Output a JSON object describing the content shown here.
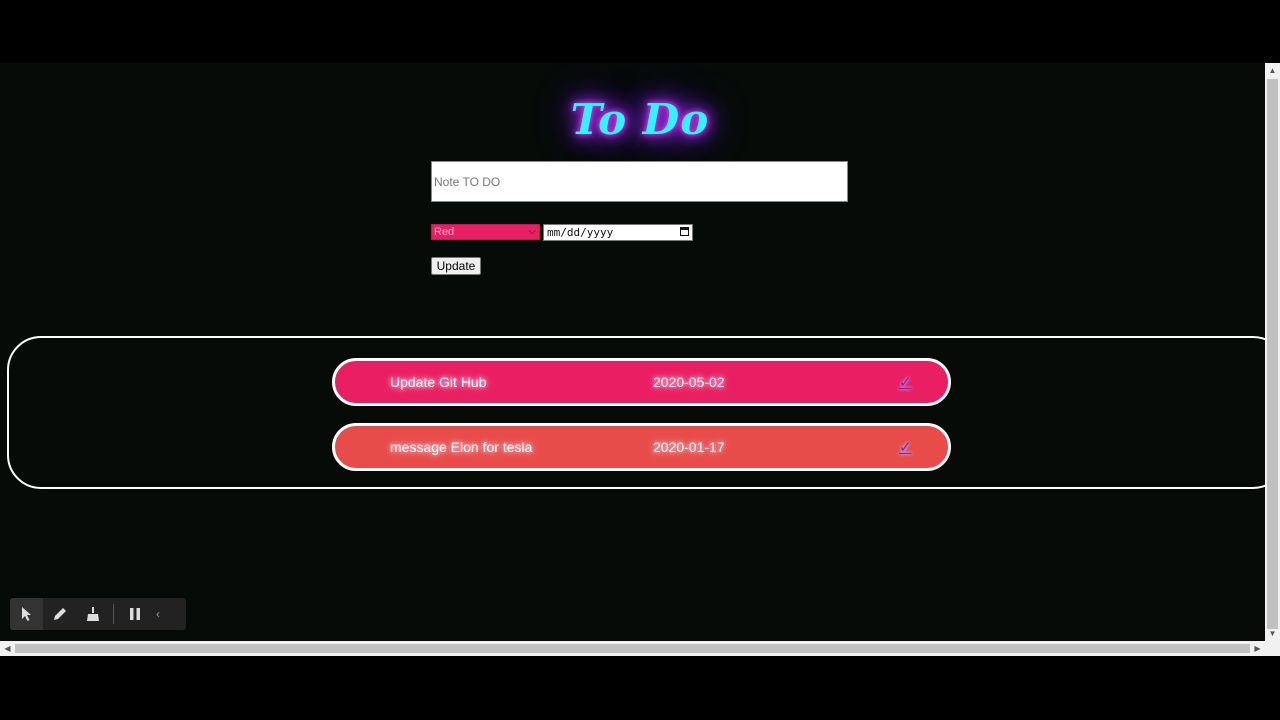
{
  "app": {
    "title": "To Do"
  },
  "form": {
    "note_placeholder": "Note TO DO",
    "color_selected": "Red",
    "date_placeholder": "mm/dd/yyyy",
    "update_label": "Update"
  },
  "todos": [
    {
      "text": "Update Git Hub",
      "date": "2020-05-02",
      "check": "✓",
      "color": "#e91e63"
    },
    {
      "text": "message Elon for tesla",
      "date": "2020-01-17",
      "check": "✓",
      "color": "#e84c4a"
    }
  ],
  "toolbar": {
    "tools": [
      "pointer-icon",
      "pencil-icon",
      "broom-icon",
      "pause-icon",
      "chevron-left-icon"
    ]
  },
  "colors": {
    "background": "#060b08",
    "title_text": "#30f4ff",
    "title_glow": "#c030ff",
    "select_bg": "#e91e63"
  }
}
